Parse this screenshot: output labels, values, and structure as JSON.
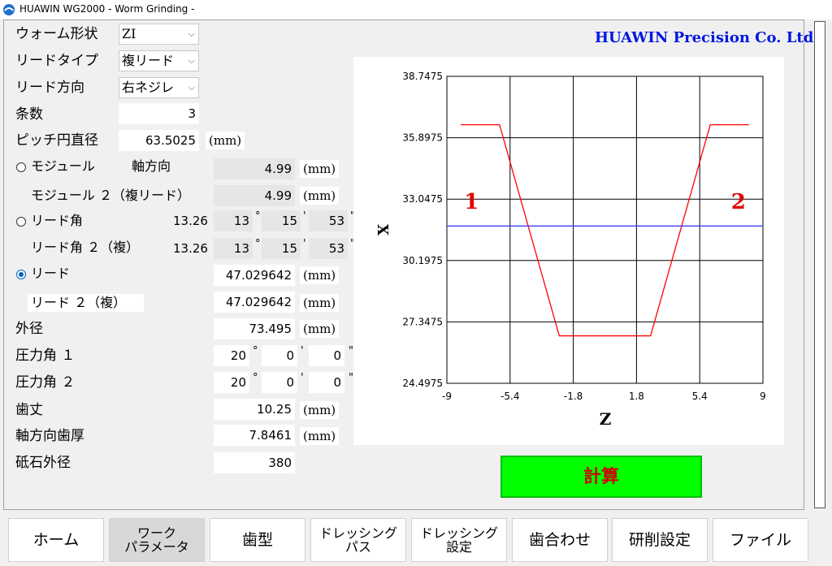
{
  "window": {
    "title": "HUAWIN WG2000 - Worm Grinding -"
  },
  "brand": "HUAWIN Precision Co. Ltd",
  "form": {
    "worm_shape": {
      "label": "ウォーム形状",
      "value": "ZI"
    },
    "lead_type": {
      "label": "リードタイプ",
      "value": "複リード"
    },
    "lead_direction": {
      "label": "リード方向",
      "value": "右ネジレ"
    },
    "starts": {
      "label": "条数",
      "value": "3"
    },
    "pitch_diameter": {
      "label": "ピッチ円直径",
      "value": "63.5025",
      "unit": "(mm)"
    },
    "module": {
      "label": "モジュール",
      "sub_label": "軸方向",
      "value": "4.99",
      "unit": "(mm)"
    },
    "module2": {
      "label": "モジュール ２（複リード）",
      "value": "4.99",
      "unit": "(mm)"
    },
    "lead_angle": {
      "label": "リード角",
      "decimal": "13.26",
      "deg": "13",
      "min": "15",
      "sec": "53"
    },
    "lead_angle2": {
      "label": "リード角 ２（複）",
      "decimal": "13.26",
      "deg": "13",
      "min": "15",
      "sec": "53"
    },
    "lead": {
      "label": "リード",
      "value": "47.029642",
      "unit": "(mm)"
    },
    "lead2": {
      "label": "リード ２（複）",
      "value": "47.029642",
      "unit": "(mm)"
    },
    "outer_diameter": {
      "label": "外径",
      "value": "73.495",
      "unit": "(mm)"
    },
    "pressure_angle1": {
      "label": "圧力角 １",
      "deg": "20",
      "min": "0",
      "sec": "0"
    },
    "pressure_angle2": {
      "label": "圧力角 ２",
      "deg": "20",
      "min": "0",
      "sec": "0"
    },
    "tooth_height": {
      "label": "歯丈",
      "value": "10.25",
      "unit": "(mm)"
    },
    "axial_thickness": {
      "label": "軸方向歯厚",
      "value": "7.8461",
      "unit": "(mm)"
    },
    "wheel_diameter": {
      "label": "砥石外径",
      "value": "380"
    }
  },
  "symbols": {
    "deg": "°",
    "min": "'",
    "sec": "\""
  },
  "calc_button": "計算",
  "tabs": [
    {
      "label": "ホーム"
    },
    {
      "label": "ワーク\nパラメータ",
      "active": true
    },
    {
      "label": "歯型"
    },
    {
      "label": "ドレッシング\nパス"
    },
    {
      "label": "ドレッシング\n設定"
    },
    {
      "label": "歯合わせ"
    },
    {
      "label": "研削設定"
    },
    {
      "label": "ファイル"
    }
  ],
  "chart_data": {
    "type": "line",
    "xlabel": "Z",
    "ylabel": "X",
    "xlim": [
      -9,
      9
    ],
    "ylim": [
      24.4975,
      38.7475
    ],
    "x_ticks": [
      "-9",
      "-5.4",
      "-1.8",
      "1.8",
      "5.4",
      "9"
    ],
    "y_ticks": [
      "38.7475",
      "35.8975",
      "33.0475",
      "30.1975",
      "27.3475",
      "24.4975"
    ],
    "grid": true,
    "annotations": [
      {
        "text": "1",
        "x": -7.6,
        "y": 32.9
      },
      {
        "text": "2",
        "x": 7.6,
        "y": 32.9
      }
    ],
    "series": [
      {
        "color": "#ff0000",
        "x": [
          -8.2,
          -6.0,
          -2.6,
          2.6,
          6.0,
          8.2
        ],
        "y": [
          36.5,
          36.5,
          26.7,
          26.7,
          36.5,
          36.5
        ]
      },
      {
        "color": "#4040ff",
        "x": [
          -9,
          9
        ],
        "y": [
          31.8,
          31.8
        ]
      }
    ]
  }
}
